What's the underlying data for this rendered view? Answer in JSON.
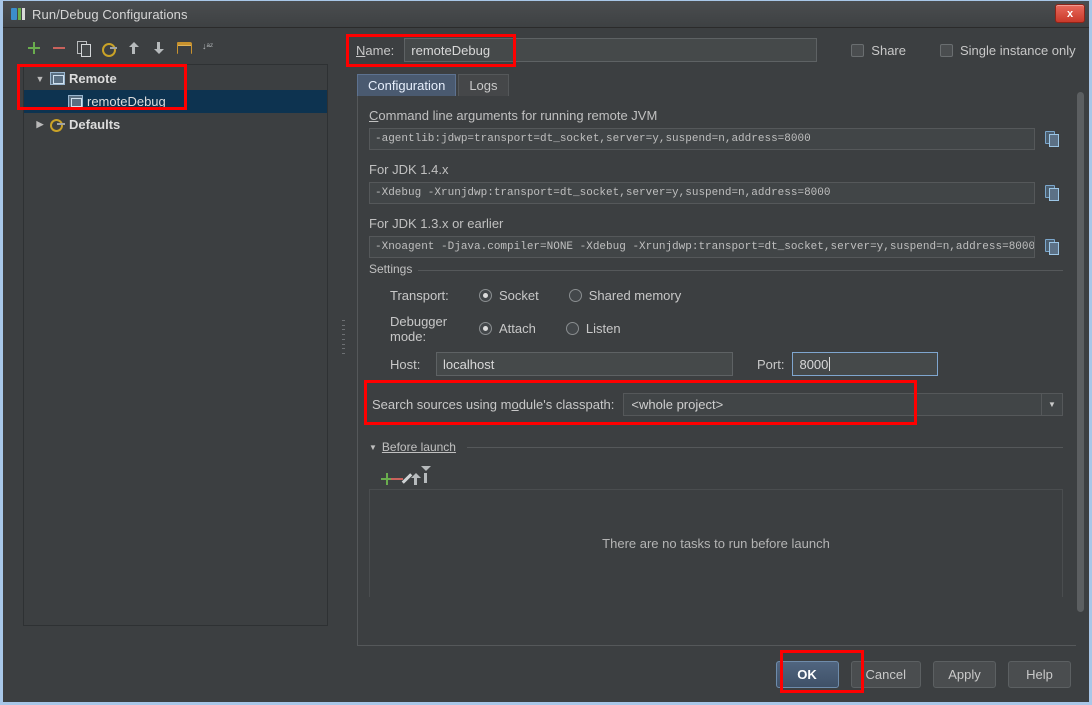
{
  "window": {
    "title": "Run/Debug Configurations",
    "icon": "intellij-idea-icon",
    "close_label": "x",
    "accent_border": "#a8c7e8",
    "annotation_color": "#ff0000"
  },
  "toolbar": {
    "buttons": [
      {
        "name": "add",
        "icon": "plus-icon",
        "tooltip": "Add New Configuration"
      },
      {
        "name": "remove",
        "icon": "minus-icon",
        "tooltip": "Remove Configuration"
      },
      {
        "name": "copy",
        "icon": "copy-icon",
        "tooltip": "Copy Configuration"
      },
      {
        "name": "save",
        "icon": "gear-save-icon",
        "tooltip": "Save Configuration"
      },
      {
        "name": "move-up",
        "icon": "arrow-up-icon",
        "tooltip": "Move Up"
      },
      {
        "name": "move-down",
        "icon": "arrow-down-icon",
        "tooltip": "Move Down"
      },
      {
        "name": "folder",
        "icon": "folder-icon",
        "tooltip": "Create New Folder"
      },
      {
        "name": "sort",
        "icon": "sort-alphabetically-icon",
        "tooltip": "Sort Configurations"
      }
    ]
  },
  "tree": {
    "nodes": [
      {
        "label": "Remote",
        "icon": "remote-config-icon",
        "expander": "▼",
        "selected": false,
        "bold": true,
        "indent": 0
      },
      {
        "label": "remoteDebug",
        "icon": "remote-config-icon",
        "expander": "",
        "selected": true,
        "bold": false,
        "indent": 1
      },
      {
        "label": "Defaults",
        "icon": "defaults-icon",
        "expander": "▶",
        "selected": false,
        "bold": true,
        "indent": 0
      }
    ],
    "selection_color": "#0d3350"
  },
  "name_row": {
    "label": "Name:",
    "value": "remoteDebug",
    "placeholder": "",
    "share": {
      "label": "Share",
      "checked": false
    },
    "single_instance": {
      "label": "Single instance only",
      "checked": false
    }
  },
  "tabs": [
    {
      "label": "Configuration",
      "active": true
    },
    {
      "label": "Logs",
      "active": false
    }
  ],
  "configuration": {
    "cmdline_label": "Command line arguments for running remote JVM",
    "cmdline_value": "-agentlib:jdwp=transport=dt_socket,server=y,suspend=n,address=8000",
    "jdk14_label": "For JDK 1.4.x",
    "jdk14_value": "-Xdebug -Xrunjdwp:transport=dt_socket,server=y,suspend=n,address=8000",
    "jdk13_label": "For JDK 1.3.x or earlier",
    "jdk13_value": "-Xnoagent -Djava.compiler=NONE -Xdebug -Xrunjdwp:transport=dt_socket,server=y,suspend=n,address=8000",
    "copy_icon_tooltip": "Copy to clipboard",
    "settings": {
      "group_label": "Settings",
      "transport_label": "Transport:",
      "transport_options": [
        {
          "label": "Socket",
          "selected": true
        },
        {
          "label": "Shared memory",
          "selected": false
        }
      ],
      "debugger_mode_label": "Debugger mode:",
      "debugger_mode_options": [
        {
          "label": "Attach",
          "selected": true
        },
        {
          "label": "Listen",
          "selected": false
        }
      ],
      "host_label": "Host:",
      "host_value": "localhost",
      "port_label": "Port:",
      "port_value": "8000",
      "port_focused": true
    },
    "search_sources_label": "Search sources using module's classpath:",
    "search_sources_value": "<whole project>",
    "search_sources_arrow": "▼"
  },
  "before_launch": {
    "title": "Before launch",
    "expander": "▼",
    "toolbar": [
      {
        "name": "add-task",
        "icon": "plus-icon"
      },
      {
        "name": "remove-task",
        "icon": "minus-icon"
      },
      {
        "name": "edit-task",
        "icon": "pencil-icon"
      },
      {
        "name": "move-task-up",
        "icon": "arrow-up-icon"
      },
      {
        "name": "move-task-down",
        "icon": "arrow-down-icon"
      }
    ],
    "empty_text": "There are no tasks to run before launch"
  },
  "footer": {
    "ok": "OK",
    "cancel": "Cancel",
    "apply": "Apply",
    "help": "Help"
  }
}
